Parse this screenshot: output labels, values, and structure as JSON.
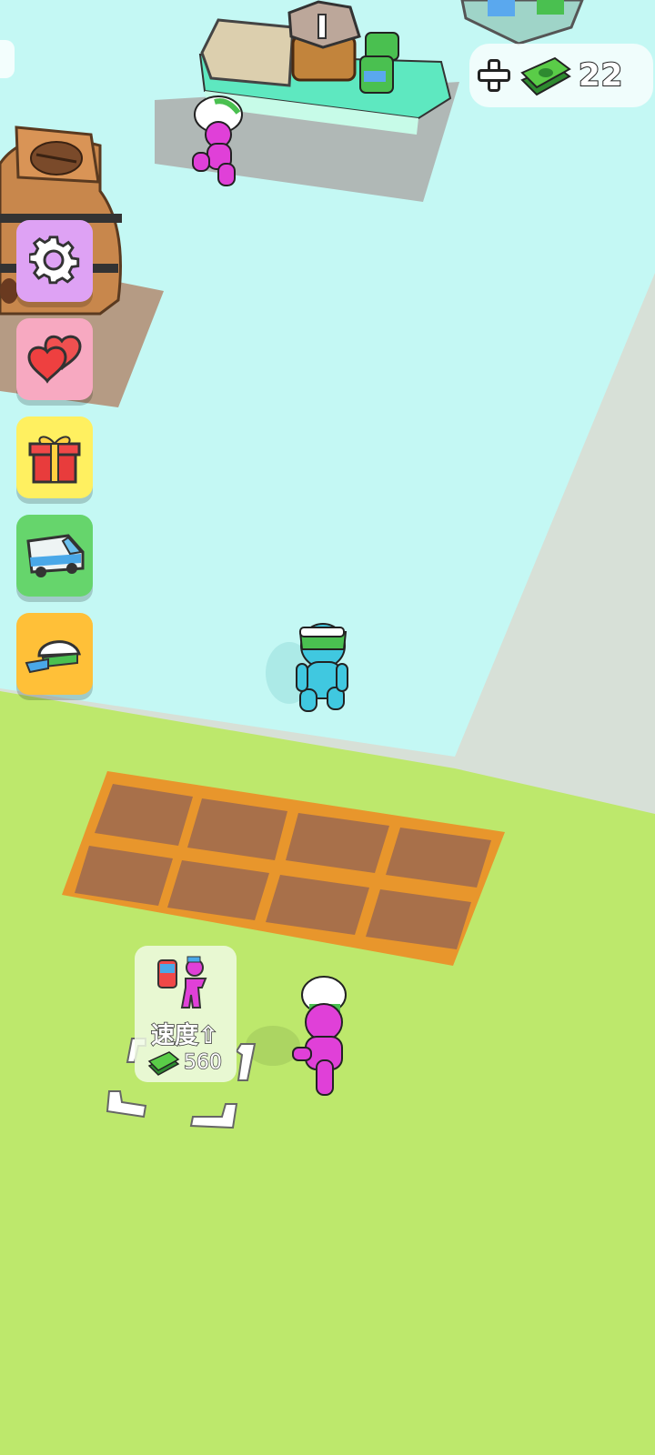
{
  "hud": {
    "money_amount": "22",
    "add_money_icon": "plus-icon",
    "cash_icon": "cash-stack-icon"
  },
  "side_menu": [
    {
      "name": "settings",
      "icon": "gear-icon",
      "color": "#dea2f4"
    },
    {
      "name": "favorites",
      "icon": "hearts-icon",
      "color": "#f7a9c1"
    },
    {
      "name": "gift",
      "icon": "gift-box-icon",
      "color": "#fff060"
    },
    {
      "name": "delivery",
      "icon": "van-icon",
      "color": "#66d56c"
    },
    {
      "name": "hat-shop",
      "icon": "cap-icon",
      "color": "#ffc038"
    }
  ],
  "upgrade_station": {
    "label": "速度",
    "cost": "560",
    "icon": "speed-upgrade-icon"
  },
  "colors": {
    "grass": "#bde86c",
    "floor": "#c4f8f4",
    "counter": "#5ee8c0",
    "plot_border": "#e8962c",
    "plot_soil": "#a8704a",
    "player": "#e040d8",
    "customer": "#40c8e0"
  }
}
